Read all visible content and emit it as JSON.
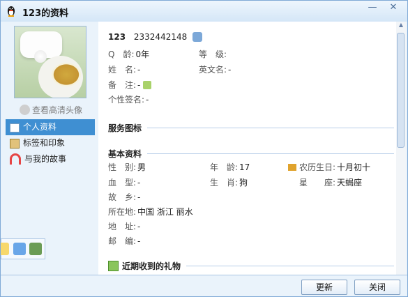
{
  "window": {
    "title": "123的资料",
    "minimize_symbol": "—",
    "close_symbol": "✕"
  },
  "sidebar": {
    "hd_avatar_link": "查看高清头像",
    "items": [
      {
        "label": "个人资料"
      },
      {
        "label": "标签和印象"
      },
      {
        "label": "与我的故事"
      }
    ]
  },
  "header": {
    "nickname": "123",
    "qq_number": "2332442148"
  },
  "basic_top": {
    "q_age_label": "Q　龄:",
    "q_age_value": "0年",
    "level_label": "等　级:",
    "name_label": "姓　名:",
    "name_value": "-",
    "english_name_label": "英文名:",
    "english_name_value": "-",
    "remark_label": "备　注:",
    "remark_value": "-",
    "signature_label": "个性签名:",
    "signature_value": "-"
  },
  "sections": {
    "service_icons": "服务图标",
    "basic_info": "基本资料",
    "recent_gifts": "近期收到的礼物"
  },
  "basic_info": {
    "gender_label": "性　别:",
    "gender_value": "男",
    "age_label": "年　龄:",
    "age_value": "17",
    "lunar_birthday_label": "农历生日:",
    "lunar_birthday_value": "十月初十",
    "blood_label": "血　型:",
    "blood_value": "-",
    "zodiac_label": "生　肖:",
    "zodiac_value": "狗",
    "constellation_label": "星　　座:",
    "constellation_value": "天蝎座",
    "hometown_label": "故　乡:",
    "hometown_value": "-",
    "location_label": "所在地:",
    "location_value": "中国 浙江 丽水",
    "address_label": "地　址:",
    "address_value": "-",
    "postcode_label": "邮　编:",
    "postcode_value": "-"
  },
  "buttons": {
    "update": "更新",
    "close": "关闭"
  }
}
